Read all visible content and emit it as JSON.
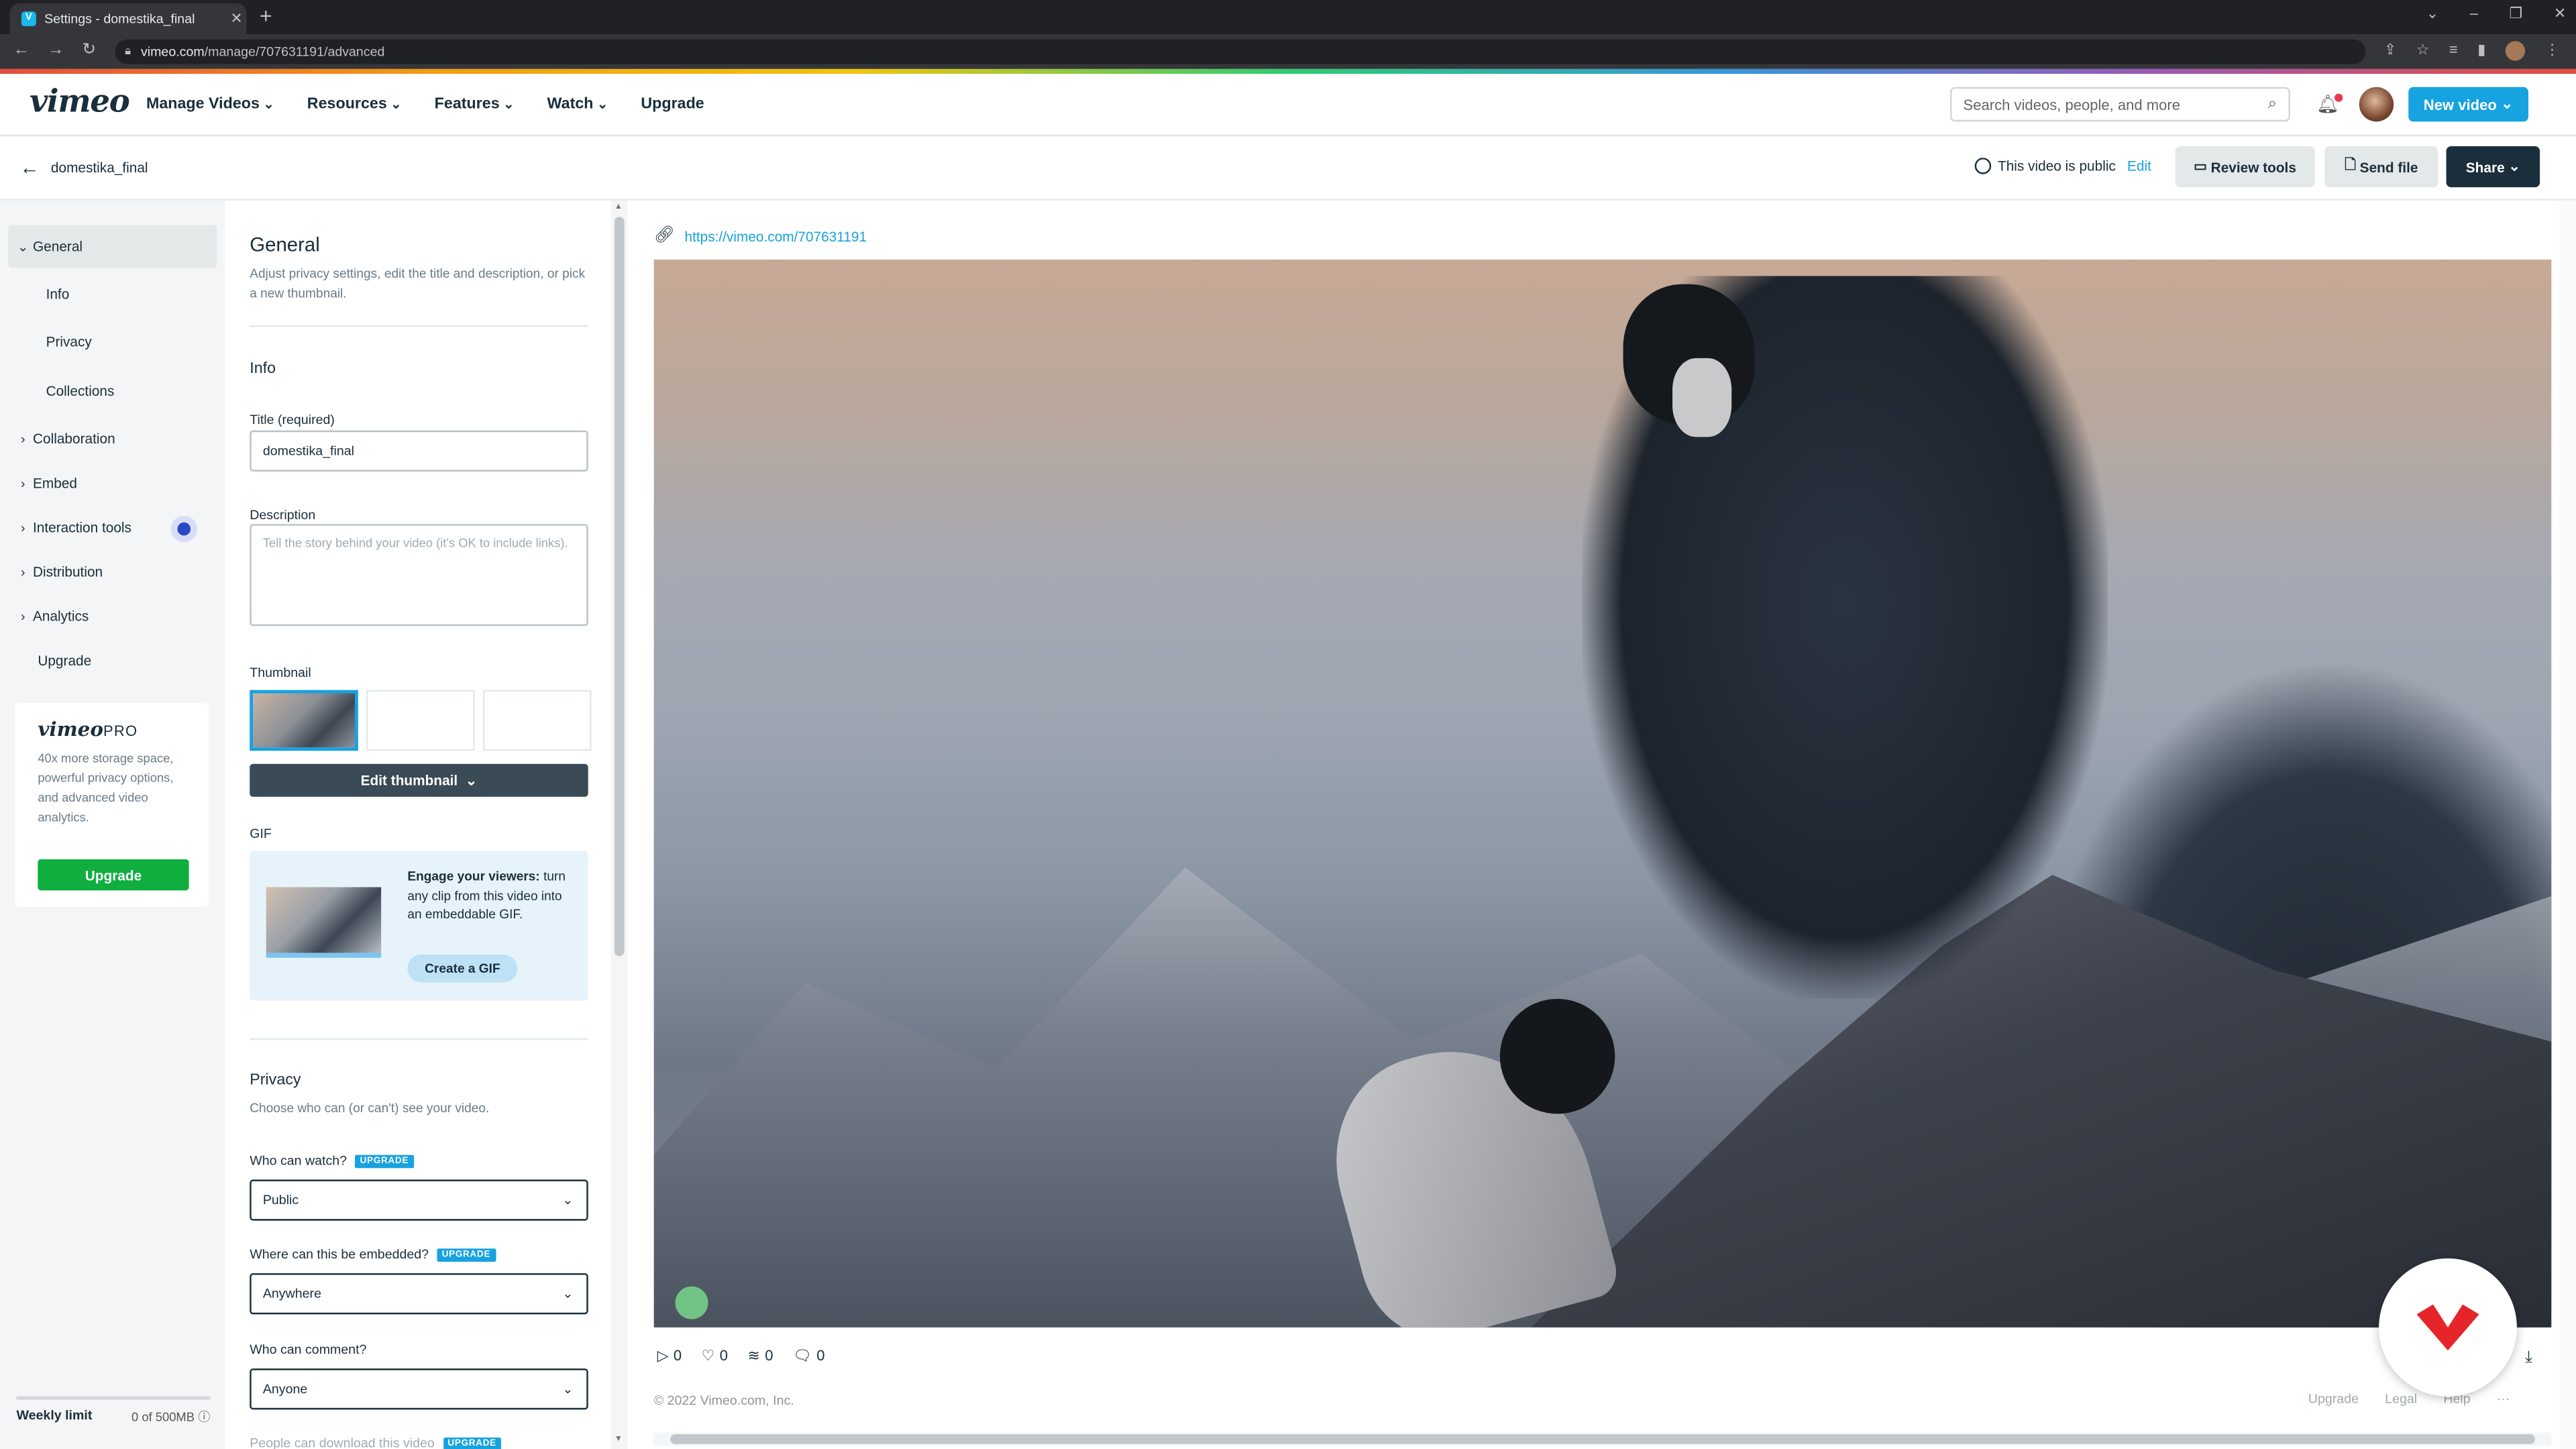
{
  "browser": {
    "tab_title": "Settings - domestika_final",
    "new_tab": "+",
    "url_host": "vimeo.com",
    "url_path": "/manage/707631191/advanced"
  },
  "header": {
    "logo": "vimeo",
    "menu": [
      "Manage Videos",
      "Resources",
      "Features",
      "Watch",
      "Upgrade"
    ],
    "search_placeholder": "Search videos, people, and more",
    "new_video": "New video"
  },
  "subheader": {
    "video_name": "domestika_final",
    "visibility": "This video is public",
    "edit": "Edit",
    "review_tools": "Review tools",
    "send_file": "Send file",
    "share": "Share"
  },
  "sidebar": {
    "items": [
      {
        "label": "General"
      },
      {
        "label": "Info"
      },
      {
        "label": "Privacy"
      },
      {
        "label": "Collections"
      },
      {
        "label": "Collaboration"
      },
      {
        "label": "Embed"
      },
      {
        "label": "Interaction tools"
      },
      {
        "label": "Distribution"
      },
      {
        "label": "Analytics"
      },
      {
        "label": "Upgrade"
      }
    ],
    "pro": {
      "logo": "vimeo",
      "logo_suffix": "PRO",
      "text": "40x more storage space, powerful privacy options, and advanced video analytics.",
      "button": "Upgrade"
    },
    "weekly_limit_label": "Weekly limit",
    "weekly_limit_value": "0 of 500MB"
  },
  "form": {
    "general_title": "General",
    "general_desc": "Adjust privacy settings, edit the title and description, or pick a new thumbnail.",
    "info_title": "Info",
    "title_label": "Title (required)",
    "title_value": "domestika_final",
    "description_label": "Description",
    "description_placeholder": "Tell the story behind your video (it's OK to include links).",
    "thumbnail_label": "Thumbnail",
    "edit_thumbnail": "Edit thumbnail",
    "gif_label": "GIF",
    "gif_bold": "Engage your viewers:",
    "gif_text": "turn any clip from this video into an embeddable GIF.",
    "create_gif": "Create a GIF",
    "privacy_title": "Privacy",
    "privacy_desc": "Choose who can (or can't) see your video.",
    "who_can_watch": "Who can watch?",
    "who_can_watch_value": "Public",
    "where_embedded": "Where can this be embedded?",
    "where_embedded_value": "Anywhere",
    "who_can_comment": "Who can comment?",
    "who_can_comment_value": "Anyone",
    "download_label": "People can download this video",
    "upgrade_badge": "UPGRADE"
  },
  "main": {
    "video_url": "https://vimeo.com/707631191",
    "plays": "0",
    "likes": "0",
    "collections": "0",
    "comments": "0",
    "copyright": "© 2022 Vimeo.com, Inc.",
    "footer_links": [
      "Upgrade",
      "Legal",
      "Help",
      "···"
    ]
  }
}
